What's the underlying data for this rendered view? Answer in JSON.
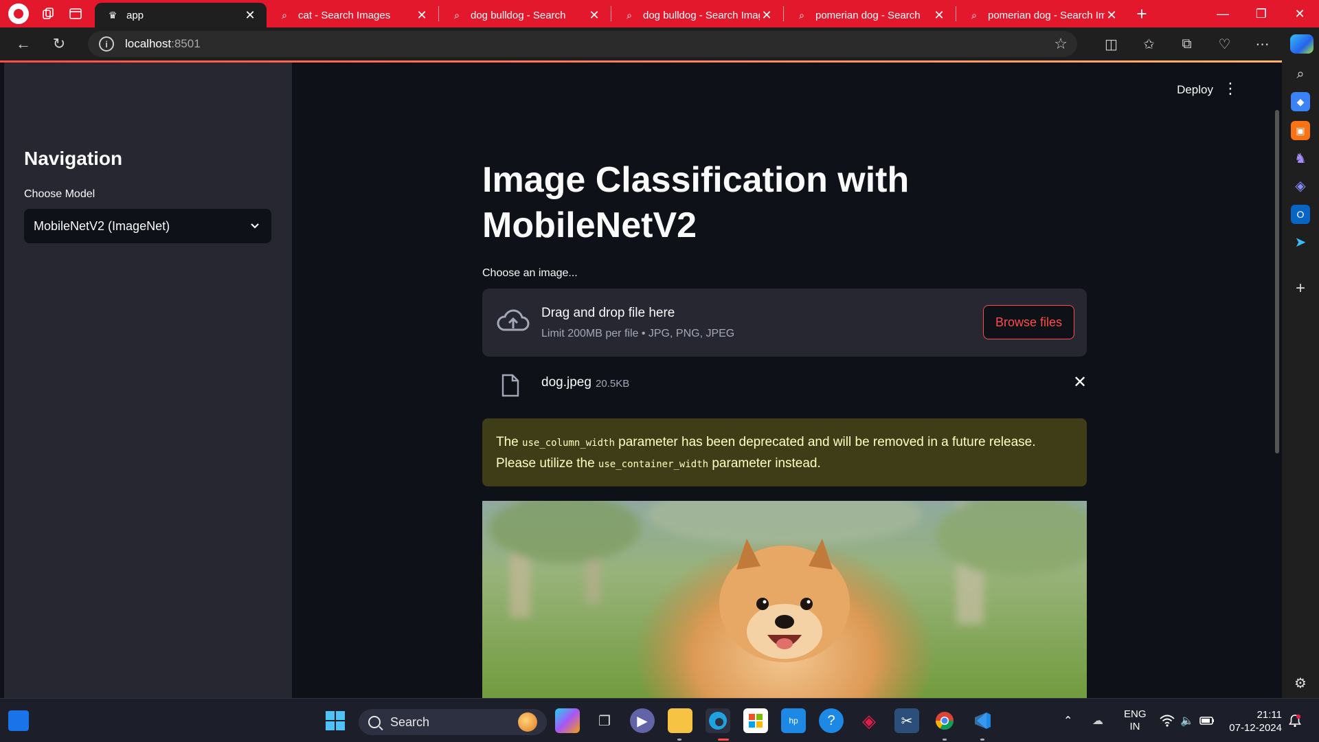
{
  "browser": {
    "tabs": [
      {
        "title": "app",
        "active": true,
        "icon": "streamlit-crown-icon"
      },
      {
        "title": "cat - Search Images",
        "active": false,
        "icon": "search-icon"
      },
      {
        "title": "dog bulldog - Search",
        "active": false,
        "icon": "search-icon"
      },
      {
        "title": "dog bulldog - Search Images",
        "active": false,
        "icon": "search-icon"
      },
      {
        "title": "pomerian dog - Search",
        "active": false,
        "icon": "search-icon"
      },
      {
        "title": "pomerian dog - Search Images",
        "active": false,
        "icon": "search-icon"
      }
    ],
    "address": {
      "host": "localhost",
      "port": ":8501"
    },
    "accent": "#e3182d"
  },
  "sidebar": {
    "title": "Navigation",
    "model_label": "Choose Model",
    "model_value": "MobileNetV2 (ImageNet)"
  },
  "header": {
    "deploy_label": "Deploy"
  },
  "main": {
    "title": "Image Classification with MobileNetV2",
    "uploader_label": "Choose an image...",
    "dropzone_title": "Drag and drop file here",
    "dropzone_subtitle": "Limit 200MB per file • JPG, PNG, JPEG",
    "browse_label": "Browse files",
    "file_name": "dog.jpeg",
    "file_size": "20.5KB",
    "warning": {
      "part1": "The ",
      "code1": "use_column_width",
      "part2": " parameter has been deprecated and will be removed in a future release. Please utilize the ",
      "code2": "use_container_width",
      "part3": " parameter instead."
    },
    "image_subject": "pomeranian-dog-photo"
  },
  "taskbar": {
    "search_label": "Search",
    "lang_line1": "ENG",
    "lang_line2": "IN",
    "time": "21:11",
    "date": "07-12-2024"
  },
  "colors": {
    "primary": "#ff4b4b",
    "sidebar_bg": "#262730",
    "main_bg": "#0e1117",
    "warning_bg": "#3e3d18",
    "warning_text": "#ffffc2"
  }
}
